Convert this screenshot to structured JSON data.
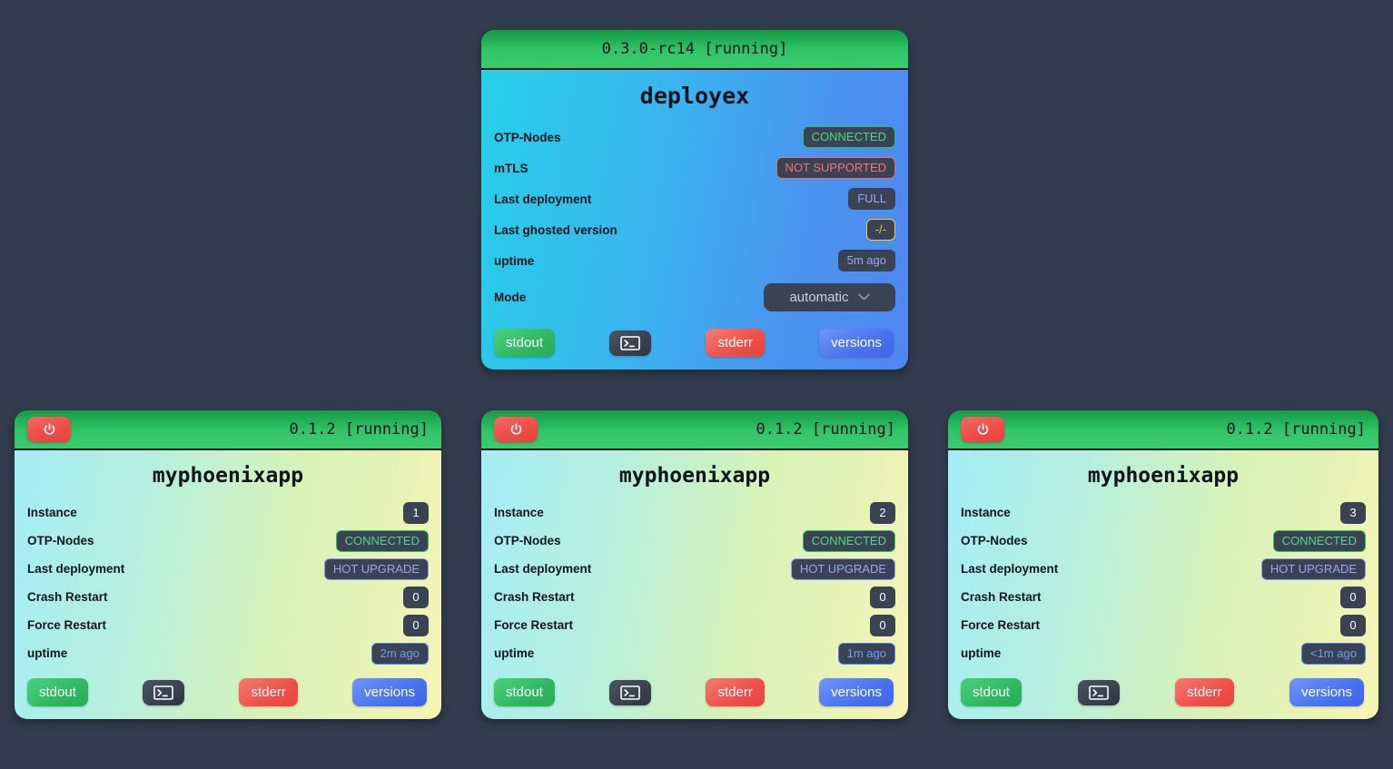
{
  "background_color": "#323c4e",
  "cards": [
    {
      "id": "deployex",
      "header": {
        "version": "0.3.0-rc14 [running]",
        "has_power_button": false,
        "power_icon": "power-icon"
      },
      "title": "deployex",
      "rows": [
        {
          "label": "OTP-Nodes",
          "value": "CONNECTED",
          "style": "green"
        },
        {
          "label": "mTLS",
          "value": "NOT SUPPORTED",
          "style": "red"
        },
        {
          "label": "Last deployment",
          "value": "FULL",
          "style": "blue-text"
        },
        {
          "label": "Last ghosted version",
          "value": "-/-",
          "style": "yellow"
        },
        {
          "label": "uptime",
          "value": "5m ago",
          "style": "blue-text"
        }
      ],
      "mode": {
        "label": "Mode",
        "value": "automatic",
        "chevron_icon": "chevron-down-icon"
      },
      "buttons": {
        "stdout": "stdout",
        "terminal_icon": "terminal-icon",
        "stderr": "stderr",
        "versions": "versions"
      }
    },
    {
      "id": "instance-1",
      "header": {
        "version": "0.1.2 [running]",
        "has_power_button": true,
        "power_icon": "power-icon"
      },
      "title": "myphoenixapp",
      "rows": [
        {
          "label": "Instance",
          "value": "1",
          "style": "counter"
        },
        {
          "label": "OTP-Nodes",
          "value": "CONNECTED",
          "style": "green"
        },
        {
          "label": "Last deployment",
          "value": "HOT UPGRADE",
          "style": "purple"
        },
        {
          "label": "Crash Restart",
          "value": "0",
          "style": "counter"
        },
        {
          "label": "Force Restart",
          "value": "0",
          "style": "counter"
        },
        {
          "label": "uptime",
          "value": "2m ago",
          "style": "blue-outline"
        }
      ],
      "buttons": {
        "stdout": "stdout",
        "terminal_icon": "terminal-icon",
        "stderr": "stderr",
        "versions": "versions"
      }
    },
    {
      "id": "instance-2",
      "header": {
        "version": "0.1.2 [running]",
        "has_power_button": true,
        "power_icon": "power-icon"
      },
      "title": "myphoenixapp",
      "rows": [
        {
          "label": "Instance",
          "value": "2",
          "style": "counter"
        },
        {
          "label": "OTP-Nodes",
          "value": "CONNECTED",
          "style": "green"
        },
        {
          "label": "Last deployment",
          "value": "HOT UPGRADE",
          "style": "purple"
        },
        {
          "label": "Crash Restart",
          "value": "0",
          "style": "counter"
        },
        {
          "label": "Force Restart",
          "value": "0",
          "style": "counter"
        },
        {
          "label": "uptime",
          "value": "1m ago",
          "style": "blue-outline"
        }
      ],
      "buttons": {
        "stdout": "stdout",
        "terminal_icon": "terminal-icon",
        "stderr": "stderr",
        "versions": "versions"
      }
    },
    {
      "id": "instance-3",
      "header": {
        "version": "0.1.2 [running]",
        "has_power_button": true,
        "power_icon": "power-icon"
      },
      "title": "myphoenixapp",
      "rows": [
        {
          "label": "Instance",
          "value": "3",
          "style": "counter"
        },
        {
          "label": "OTP-Nodes",
          "value": "CONNECTED",
          "style": "green"
        },
        {
          "label": "Last deployment",
          "value": "HOT UPGRADE",
          "style": "purple"
        },
        {
          "label": "Crash Restart",
          "value": "0",
          "style": "counter"
        },
        {
          "label": "Force Restart",
          "value": "0",
          "style": "counter"
        },
        {
          "label": "uptime",
          "value": "<1m ago",
          "style": "blue-outline"
        }
      ],
      "buttons": {
        "stdout": "stdout",
        "terminal_icon": "terminal-icon",
        "stderr": "stderr",
        "versions": "versions"
      }
    }
  ]
}
